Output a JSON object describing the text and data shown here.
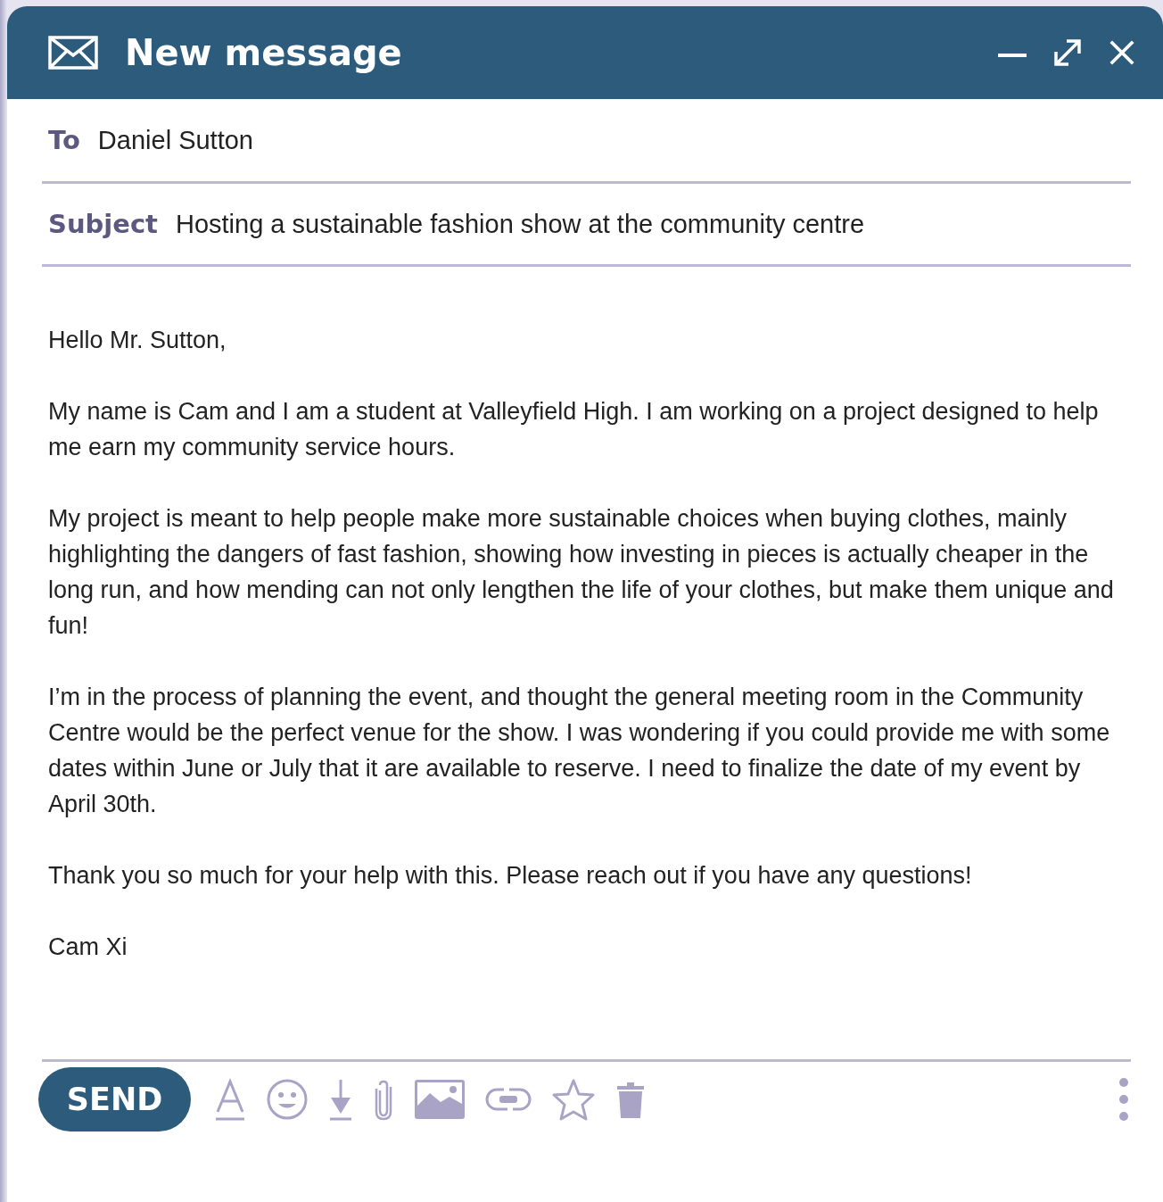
{
  "window": {
    "title": "New message"
  },
  "to": {
    "label": "To",
    "value": "Daniel Sutton"
  },
  "subject": {
    "label": "Subject",
    "value": "Hosting a sustainable fashion show at the community centre"
  },
  "body": [
    "Hello Mr. Sutton,",
    "My name is Cam and I am a student at Valleyfield High. I am working on a project designed to help me earn my community service hours.",
    "My project is meant to help people make more sustainable choices when buying clothes, mainly highlighting the dangers of fast fashion, showing how investing in pieces is actually cheaper in the long run, and how mending can not only lengthen the life of your clothes, but make them unique and fun!",
    "I’m in the process of planning the event, and thought the general meeting room in the Community Centre would be the perfect venue for the show. I was wondering if you could provide me with some dates within June or July that it are available to reserve. I need to finalize the date of my event by April 30th.",
    "Thank you so much for your help with this. Please reach out if you have any questions!",
    "Cam Xi"
  ],
  "send_button": "SEND"
}
